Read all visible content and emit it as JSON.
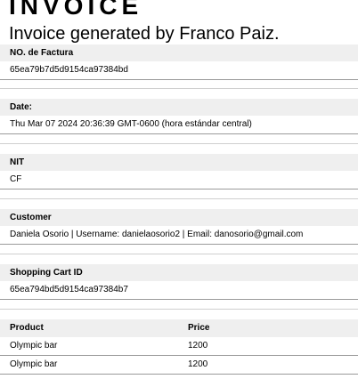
{
  "invoice": {
    "title": "INVOICE",
    "subtitle": "Invoice generated by Franco Paiz."
  },
  "fields": {
    "invoice_no": {
      "label": "NO. de Factura",
      "value": "65ea79b7d5d9154ca97384bd"
    },
    "date": {
      "label": "Date:",
      "value": "Thu Mar 07 2024 20:36:39 GMT-0600 (hora estándar central)"
    },
    "nit": {
      "label": "NIT",
      "value": "CF"
    },
    "customer": {
      "label": "Customer",
      "value": "Daniela Osorio |  Username: danielaosorio2  |  Email: danosorio@gmail.com"
    },
    "cart_id": {
      "label": "Shopping Cart ID",
      "value": "65ea794bd5d9154ca97384b7"
    }
  },
  "items_table": {
    "headers": [
      "Product",
      "Price"
    ],
    "rows": [
      [
        "Olympic bar",
        "1200"
      ],
      [
        "Olympic bar",
        "1200"
      ]
    ]
  }
}
